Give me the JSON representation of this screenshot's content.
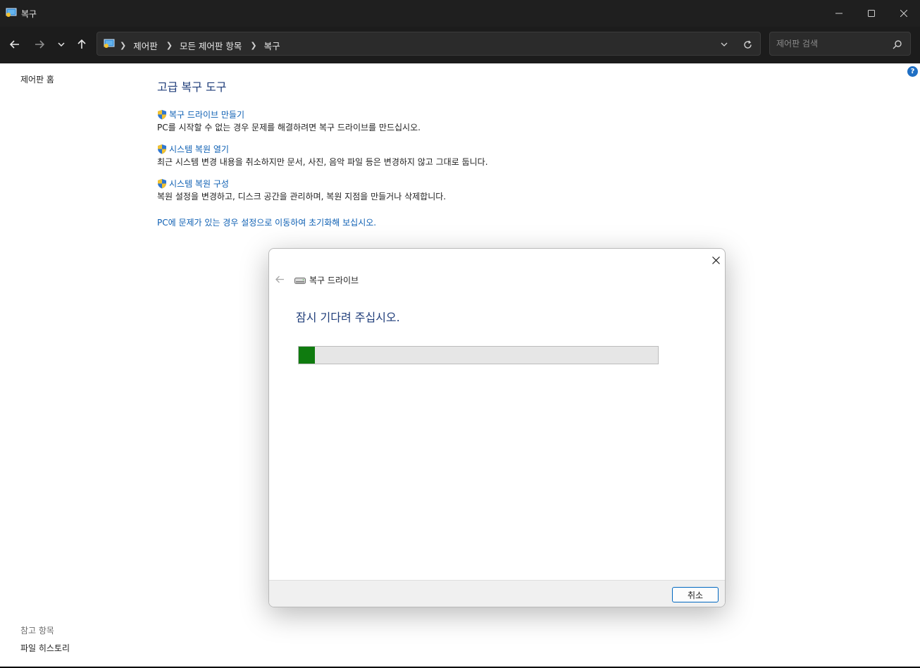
{
  "window": {
    "title": "복구"
  },
  "nav": {
    "breadcrumbs": [
      "제어판",
      "모든 제어판 항목",
      "복구"
    ],
    "search_placeholder": "제어판 검색"
  },
  "sidebar": {
    "home": "제어판 홈",
    "see_also_header": "참고 항목",
    "see_also_items": [
      "파일 히스토리"
    ]
  },
  "main": {
    "heading": "고급 복구 도구",
    "tasks": [
      {
        "link": "복구 드라이브 만들기",
        "desc": "PC를 시작할 수 없는 경우 문제를 해결하려면 복구 드라이브를 만드십시오."
      },
      {
        "link": "시스템 복원 열기",
        "desc": "최근 시스템 변경 내용을 취소하지만 문서, 사진, 음악 파일 등은 변경하지 않고 그대로 둡니다."
      },
      {
        "link": "시스템 복원 구성",
        "desc": "복원 설정을 변경하고, 디스크 공간을 관리하며, 복원 지점을 만들거나 삭제합니다."
      }
    ],
    "reset_link": "PC에 문제가 있는 경우 설정으로 이동하여 초기화해 보십시오."
  },
  "dialog": {
    "title": "복구 드라이브",
    "message": "잠시 기다려 주십시오.",
    "progress_percent": 4.5,
    "cancel_label": "취소"
  },
  "colors": {
    "accent": "#0067c0",
    "progress_fill": "#0f7b0f",
    "link": "#0d5fb3",
    "heading": "#1e3c79"
  }
}
